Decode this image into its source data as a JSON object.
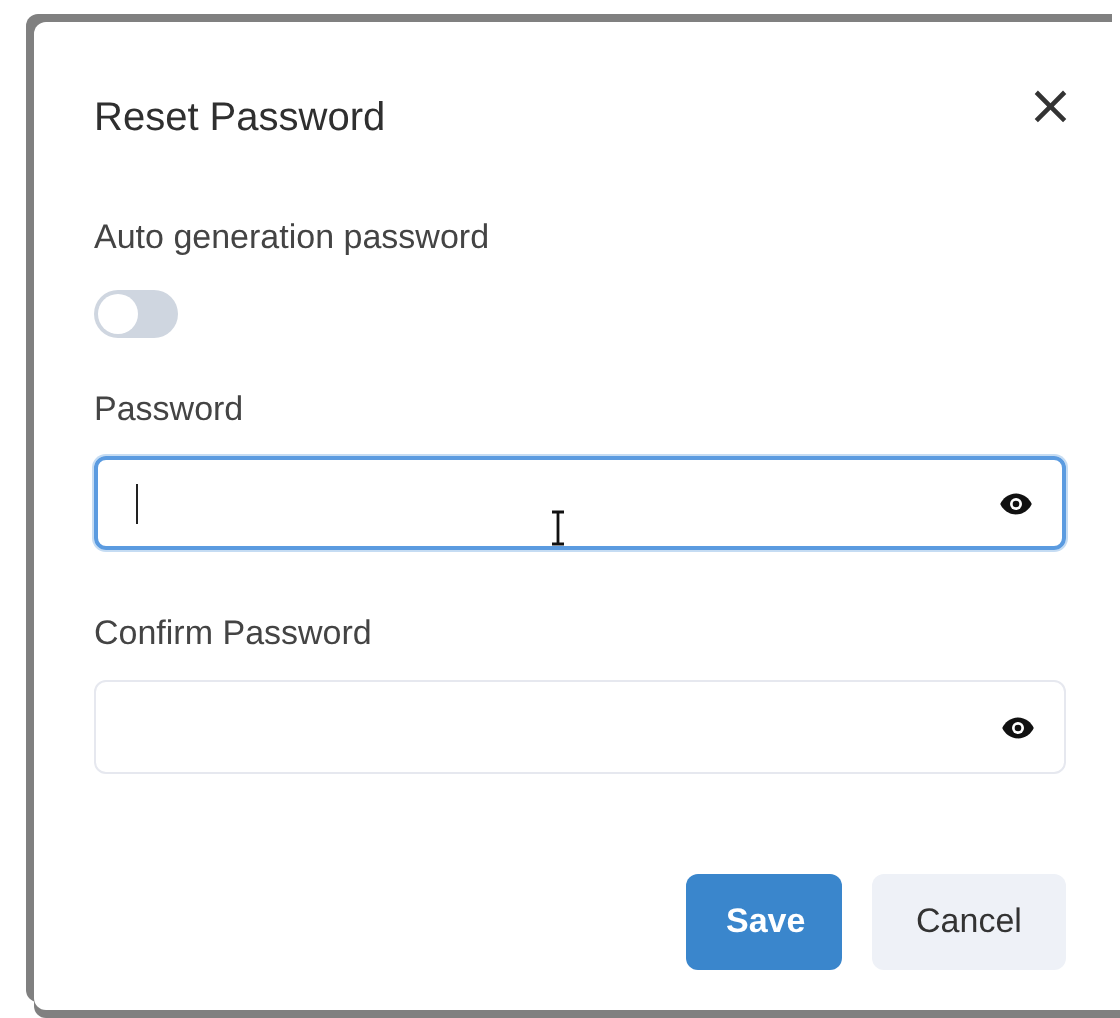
{
  "dialog": {
    "title": "Reset Password",
    "close": "×"
  },
  "toggle": {
    "label": "Auto generation password",
    "on": false
  },
  "fields": [
    {
      "label": "Password",
      "focused": true
    },
    {
      "label": "Confirm Password",
      "focused": false
    }
  ],
  "buttons": [
    {
      "label": "Save",
      "kind": "primary"
    },
    {
      "label": "Cancel",
      "kind": "secondary"
    }
  ]
}
